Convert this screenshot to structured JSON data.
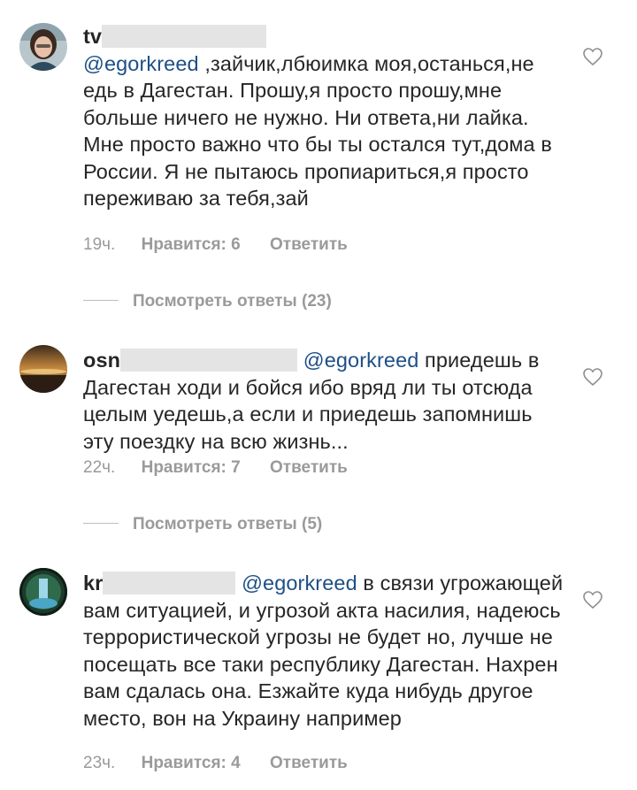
{
  "comments": [
    {
      "username_visible": "tv",
      "mention": "@egorkreed",
      "text": " ,зайчик,лбюимка моя,останься,не едь в Дагестан. Прошу,я просто прошу,мне больше ничего не нужно. Ни ответа,ни лайка. Мне просто важно что бы ты остался тут,дома в России. Я не пытаюсь пропиариться,я просто переживаю за тебя,зай",
      "time": "19ч.",
      "likes_label": "Нравится: 6",
      "reply_label": "Ответить",
      "view_replies": "Посмотреть ответы (23)"
    },
    {
      "username_visible": "osn",
      "mention": "@egorkreed",
      "text": "  приедешь в Дагестан ходи и бойся ибо вряд ли ты отсюда целым уедешь,а если и приедешь запомнишь эту поездку на всю жизнь...",
      "time": "22ч.",
      "likes_label": "Нравится: 7",
      "reply_label": "Ответить",
      "view_replies": "Посмотреть ответы (5)"
    },
    {
      "username_visible": "kr",
      "mention": "@egorkreed",
      "text": "  в связи угрожающей вам ситуацией, и угрозой акта насилия, надеюсь террористической угрозы не будет но, лучше не посещать все таки республику Дагестан. Нахрен вам сдалась она. Езжайте куда нибудь другое место, вон на Украину например",
      "time": "23ч.",
      "likes_label": "Нравится: 4",
      "reply_label": "Ответить"
    }
  ],
  "icons": {
    "like": "heart-outline-icon",
    "avatar1": "avatar-photo",
    "avatar2": "avatar-sunset",
    "avatar3": "avatar-waterfall"
  },
  "colors": {
    "mention": "#1d4f87",
    "meta": "#9a9a9a",
    "text": "#262626"
  }
}
